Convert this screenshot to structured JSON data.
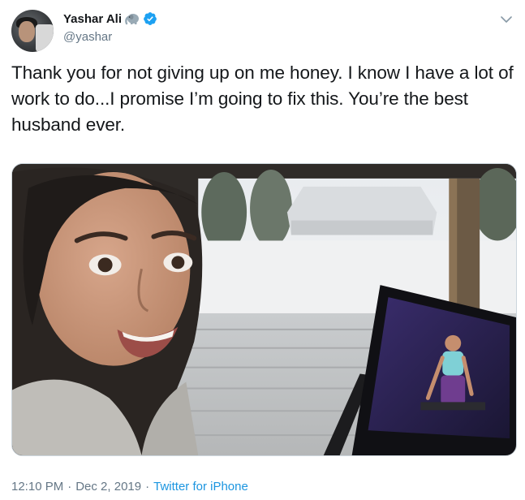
{
  "author": {
    "display_name": "Yashar Ali",
    "handle": "@yashar",
    "name_emoji_icon": "elephant-icon",
    "verified": true,
    "verified_color": "#1da1f2"
  },
  "tweet": {
    "text": "Thank you for not giving up on me honey. I know I have a lot of work to do...I promise I’m going to fix this. You’re the best husband ever."
  },
  "media": {
    "type": "photo",
    "icon": "photo"
  },
  "meta": {
    "time": "12:10 PM",
    "separator": "·",
    "date": "Dec 2, 2019",
    "source": "Twitter for iPhone",
    "link_color": "#1b95e0"
  },
  "menu": {
    "icon": "chevron-down-icon"
  }
}
